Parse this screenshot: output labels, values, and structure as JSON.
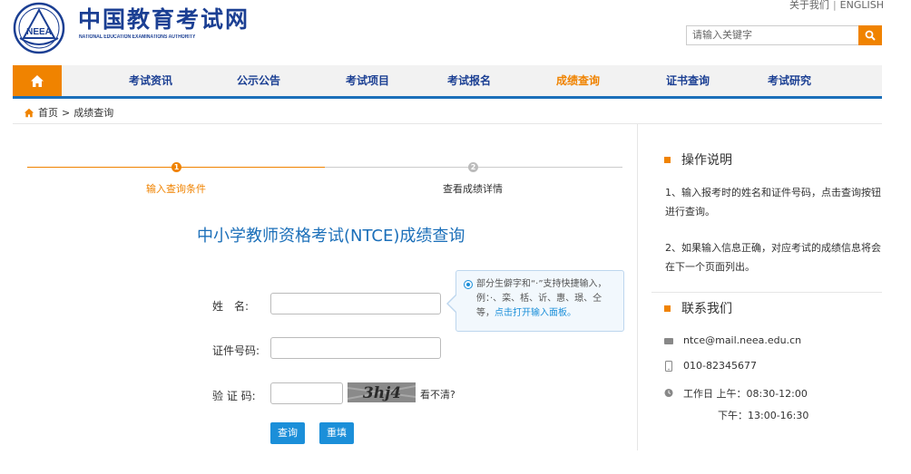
{
  "header": {
    "logo_cn": "中国教育考试网",
    "logo_en": "NATIONAL EDUCATION EXAMINATIONS AUTHORITY",
    "emblem_text": "NEEA",
    "top_links": [
      "关于我们",
      "ENGLISH"
    ],
    "search_placeholder": "请输入关键字"
  },
  "nav": {
    "items": [
      "考试资讯",
      "公示公告",
      "考试项目",
      "考试报名",
      "成绩查询",
      "证书查询",
      "考试研究"
    ],
    "active_index": 4
  },
  "breadcrumb": {
    "home": "首页",
    "separator": ">",
    "current": "成绩查询"
  },
  "steps": {
    "items": [
      {
        "num": "1",
        "label": "输入查询条件"
      },
      {
        "num": "2",
        "label": "查看成绩详情"
      }
    ]
  },
  "form": {
    "title": "中小学教师资格考试(NTCE)成绩查询",
    "name_label": "姓　名:",
    "id_label": "证件号码:",
    "captcha_label": "验 证 码:",
    "captcha_text": "3hj4",
    "captcha_refresh": "看不清?",
    "submit": "查询",
    "reset": "重填"
  },
  "tooltip": {
    "text": "部分生僻字和“·”支持快捷输入，例：·、栾、栝、䜣、惠、璟、仝等，",
    "link": "点击打开输入面板。"
  },
  "sidebar": {
    "instructions_title": "操作说明",
    "instructions": [
      "1、输入报考时的姓名和证件号码，点击查询按钮进行查询。",
      "2、如果输入信息正确，对应考试的成绩信息将会在下一个页面列出。"
    ],
    "contact_title": "联系我们",
    "email": "ntce@mail.neea.edu.cn",
    "phone": "010-82345677",
    "hours_1": "工作日 上午：08:30-12:00",
    "hours_2": "下午：13:00-16:30"
  },
  "colors": {
    "brand_blue": "#1b3f93",
    "accent_orange": "#f08300",
    "link_blue": "#1b8fd9"
  }
}
